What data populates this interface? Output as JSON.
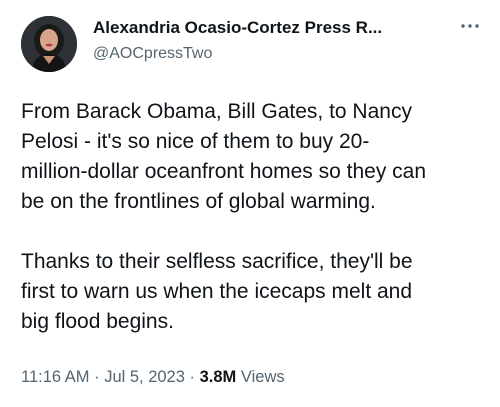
{
  "author": {
    "display_name": "Alexandria Ocasio-Cortez Press R...",
    "handle": "@AOCpressTwo",
    "avatar_icon": "profile-photo"
  },
  "menu": {
    "icon": "more-options-icon"
  },
  "tweet": {
    "paragraphs": [
      {
        "lines": [
          "From Barack Obama, Bill Gates, to Nancy",
          "Pelosi - it's so nice of them to buy 20-",
          "million-dollar oceanfront homes so they can",
          "be on the frontlines of global warming."
        ]
      },
      {
        "lines": [
          "Thanks to their selfless sacrifice, they'll be",
          "first to warn us when the icecaps melt and",
          "big flood begins."
        ]
      }
    ]
  },
  "meta": {
    "time": "11:16 AM",
    "separator": "·",
    "date": "Jul 5, 2023",
    "views_count": "3.8M",
    "views_label": "Views"
  },
  "colors": {
    "text_primary": "#0f1419",
    "text_secondary": "#536471",
    "background": "#ffffff"
  }
}
